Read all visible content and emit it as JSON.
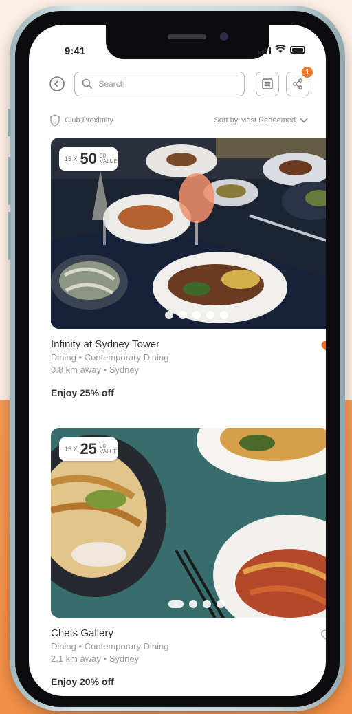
{
  "status": {
    "time": "9:41"
  },
  "search": {
    "placeholder": "Search"
  },
  "header": {
    "notification_count": "1"
  },
  "filters": {
    "location": "Club Proximity",
    "sort": "Sort by Most Redeemed"
  },
  "cards": [
    {
      "name": "Infinity at Sydney Tower",
      "category": "Dining • Contemporary Dining",
      "distance": "0.8 km away • Sydney",
      "offer": "Enjoy 25% off",
      "points_multiplier": "15 X",
      "points_value": "50",
      "points_unit": "00 VALUE",
      "favorited": true
    },
    {
      "name": "Chefs Gallery",
      "category": "Dining • Contemporary Dining",
      "distance": "2.1 km away • Sydney",
      "offer": "Enjoy 20% off",
      "points_multiplier": "15 X",
      "points_value": "25",
      "points_unit": "00 VALUE",
      "favorited": false
    }
  ],
  "colors": {
    "accent": "#f4772a",
    "favorite": "#f06a1e",
    "text": "#333333",
    "muted": "#9a9a9a"
  },
  "icons": [
    "back-icon",
    "search-icon",
    "list-icon",
    "share-icon",
    "shield-icon",
    "chevron-down-icon",
    "heart-filled-icon",
    "heart-outline-icon"
  ]
}
